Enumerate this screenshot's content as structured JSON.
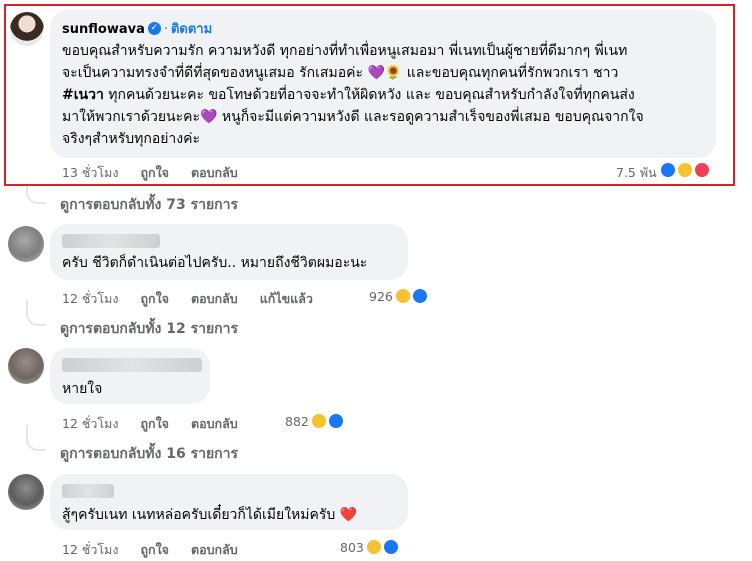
{
  "main_comment": {
    "author": "sunflowava",
    "verified_icon": "verified-badge-icon",
    "follow_label": "ติดตาม",
    "line1": "ขอบคุณสำหรับความรัก ความหวังดี ทุกอย่างที่ทำเพื่อหนูเสมอมา พี่เนทเป็นผู้ชายที่ดีมากๆ พี่เนท",
    "line2": "จะเป็นความทรงจำที่ดีที่สุดของหนูเสมอ รักเสมอค่ะ 💜🌻 และขอบคุณทุกคนที่รักพวกเรา ชาว",
    "line3_tag": "#เนวา",
    "line3": " ทุกคนด้วยนะคะ ขอโทษด้วยที่อาจจะทำให้ผิดหวัง และ ขอบคุณสำหรับกำลังใจที่ทุกคนส่ง",
    "line4": "มาให้พวกเราด้วยนะคะ💜 หนูก็จะมีแต่ความหวังดี และรอดูความสำเร็จของพี่เสมอ ขอบคุณจากใจ",
    "line5": "จริงๆสำหรับทุกอย่างค่ะ",
    "time": "13 ชั่วโมง",
    "like_label": "ถูกใจ",
    "reply_label": "ตอบกลับ",
    "reaction_count": "7.5 พัน",
    "reactions": [
      "like",
      "care",
      "love"
    ],
    "view_replies": "ดูการตอบกลับทั้ง 73 รายการ"
  },
  "replies": [
    {
      "text": "ครับ ชีวิตก็ดำเนินต่อไปครับ.. หมายถึงชีวิตผมอะนะ",
      "time": "12 ชั่วโมง",
      "like_label": "ถูกใจ",
      "reply_label": "ตอบกลับ",
      "edited_label": "แก้ไขแล้ว",
      "reaction_count": "926",
      "reactions": [
        "haha",
        "like"
      ],
      "view_replies": "ดูการตอบกลับทั้ง 12 รายการ"
    },
    {
      "text": "หายใจ",
      "time": "12 ชั่วโมง",
      "like_label": "ถูกใจ",
      "reply_label": "ตอบกลับ",
      "reaction_count": "882",
      "reactions": [
        "haha",
        "like"
      ],
      "view_replies": "ดูการตอบกลับทั้ง 16 รายการ"
    },
    {
      "text": "สู้ๆครับเนท เนทหล่อครับเดี๋ยวก็ได้เมียใหม่ครับ ❤️",
      "time": "12 ชั่วโมง",
      "like_label": "ถูกใจ",
      "reply_label": "ตอบกลับ",
      "reaction_count": "803",
      "reactions": [
        "haha",
        "like"
      ]
    }
  ],
  "colors": {
    "highlight_border": "#d6202a",
    "bubble_bg": "#f0f2f5",
    "link_blue": "#1877f2",
    "meta_gray": "#65676b"
  }
}
